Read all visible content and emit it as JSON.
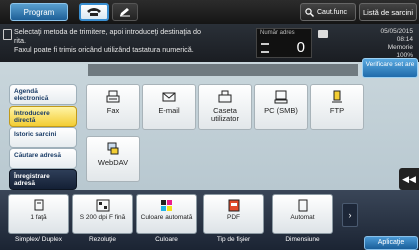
{
  "topbar": {
    "program_label": "Program",
    "search_label": "Caut.func",
    "jobs_label": "Listă de sarcini",
    "icons": [
      "fax-phone-icon",
      "edit-pen-icon",
      "search-icon"
    ]
  },
  "message": {
    "line1": "Selectaţi metoda de trimitere, apoi introduceţi destinaţia do",
    "line2": "rita.",
    "line3": "Faxul poate fi trimis oricând utilizând tastatura numerică."
  },
  "address_count": {
    "label": "Număr adres",
    "value": "0"
  },
  "datetime": {
    "date": "05/05/2015",
    "time": "08:14",
    "memory_label": "Memorie",
    "memory_value": "100%"
  },
  "verify_button": "Verificare set are",
  "tabs": [
    {
      "label": "Agendă electronică"
    },
    {
      "label": "Introducere directă"
    },
    {
      "label": "Istoric sarcini"
    },
    {
      "label": "Căutare adresă"
    },
    {
      "label": "Înregistrare adresă"
    }
  ],
  "destinations": [
    {
      "label": "Fax",
      "icon": "fax-icon"
    },
    {
      "label": "E-mail",
      "icon": "envelope-icon"
    },
    {
      "label": "Caseta utilizator",
      "icon": "user-box-icon"
    },
    {
      "label": "PC (SMB)",
      "icon": "pc-icon"
    },
    {
      "label": "FTP",
      "icon": "ftp-icon"
    },
    {
      "label": "WebDAV",
      "icon": "webdav-icon"
    }
  ],
  "settings": [
    {
      "value": "1 faţă",
      "label": "Simplex/ Duplex",
      "icon": "simplex-icon"
    },
    {
      "value": "S 200 dpi F fină",
      "label": "Rezoluţie",
      "icon": "resolution-icon"
    },
    {
      "value": "Culoare automată",
      "label": "Culoare",
      "icon": "color-icon"
    },
    {
      "value": "PDF",
      "label": "Tip de fişier",
      "icon": "pdf-icon"
    },
    {
      "value": "Automat",
      "label": "Dimensiune",
      "icon": "size-icon"
    }
  ],
  "apps_label": "Aplicaţie",
  "colors": {
    "accent_blue": "#1f6bab",
    "active_tab": "#f3cd33",
    "dark_tab": "#142035"
  }
}
